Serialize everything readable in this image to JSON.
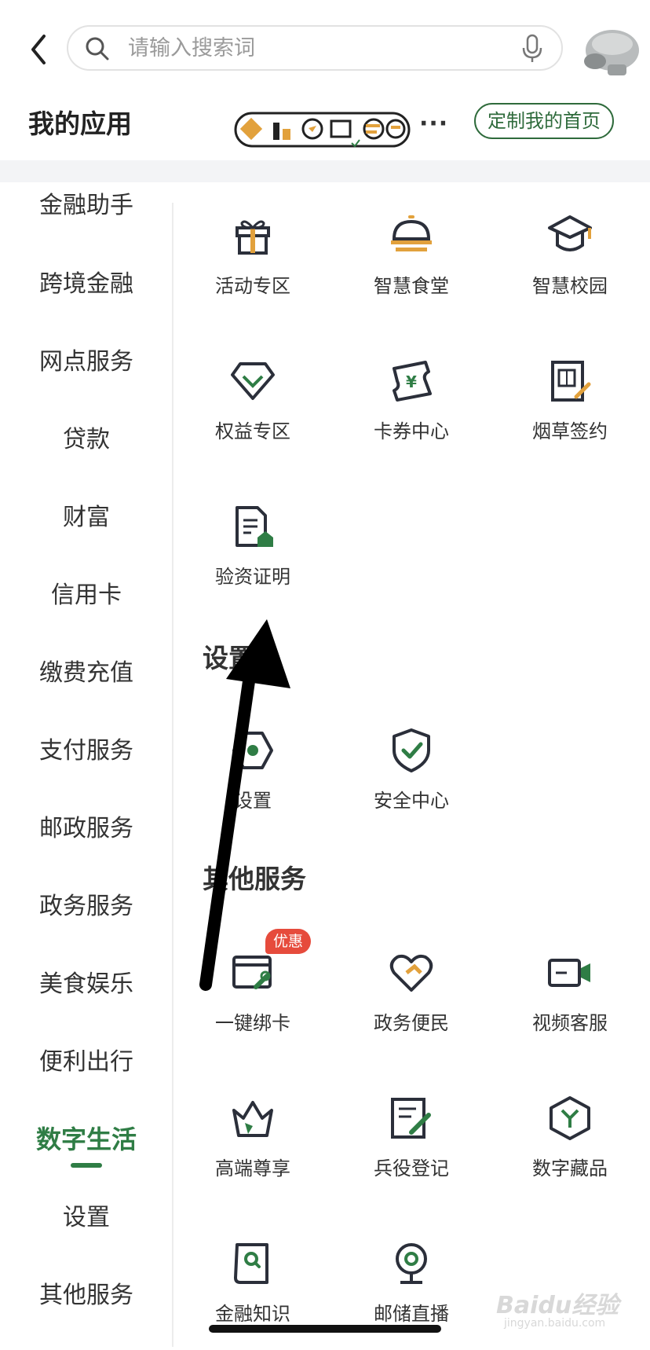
{
  "search": {
    "placeholder": "请输入搜索词"
  },
  "app_header": {
    "title": "我的应用",
    "more": "···",
    "customize_button": "定制我的首页"
  },
  "sidebar": {
    "items": [
      {
        "label": "金融助手"
      },
      {
        "label": "跨境金融"
      },
      {
        "label": "网点服务"
      },
      {
        "label": "贷款"
      },
      {
        "label": "财富"
      },
      {
        "label": "信用卡"
      },
      {
        "label": "缴费充值"
      },
      {
        "label": "支付服务"
      },
      {
        "label": "邮政服务"
      },
      {
        "label": "政务服务"
      },
      {
        "label": "美食娱乐"
      },
      {
        "label": "便利出行"
      },
      {
        "label": "数字生活",
        "active": true
      },
      {
        "label": "设置"
      },
      {
        "label": "其他服务"
      }
    ]
  },
  "content": {
    "group_top": [
      {
        "label": "活动专区",
        "icon": "gift-icon"
      },
      {
        "label": "智慧食堂",
        "icon": "dish-cover-icon"
      },
      {
        "label": "智慧校园",
        "icon": "graduation-cap-icon"
      },
      {
        "label": "权益专区",
        "icon": "diamond-icon"
      },
      {
        "label": "卡券中心",
        "icon": "coupon-icon"
      },
      {
        "label": "烟草签约",
        "icon": "tobacco-sign-icon"
      },
      {
        "label": "验资证明",
        "icon": "document-icon"
      }
    ],
    "settings_section": {
      "title": "设置",
      "items": [
        {
          "label": "设置",
          "icon": "gear-hexagon-icon"
        },
        {
          "label": "安全中心",
          "icon": "shield-check-icon"
        }
      ]
    },
    "other_section": {
      "title": "其他服务",
      "badge": "优惠",
      "items": [
        {
          "label": "一键绑卡",
          "icon": "card-link-icon"
        },
        {
          "label": "政务便民",
          "icon": "heart-handshake-icon"
        },
        {
          "label": "视频客服",
          "icon": "video-icon"
        },
        {
          "label": "高端尊享",
          "icon": "crown-icon"
        },
        {
          "label": "兵役登记",
          "icon": "form-edit-icon"
        },
        {
          "label": "数字藏品",
          "icon": "hexagon-y-icon"
        },
        {
          "label": "金融知识",
          "icon": "book-search-icon"
        },
        {
          "label": "邮储直播",
          "icon": "webcam-icon"
        }
      ]
    }
  },
  "watermark": {
    "brand": "Baidu经验",
    "url": "jingyan.baidu.com"
  },
  "colors": {
    "accent": "#2f7d45",
    "icon_dark": "#2b2f3a",
    "icon_gold": "#e2a13c",
    "badge": "#e64b3c"
  }
}
